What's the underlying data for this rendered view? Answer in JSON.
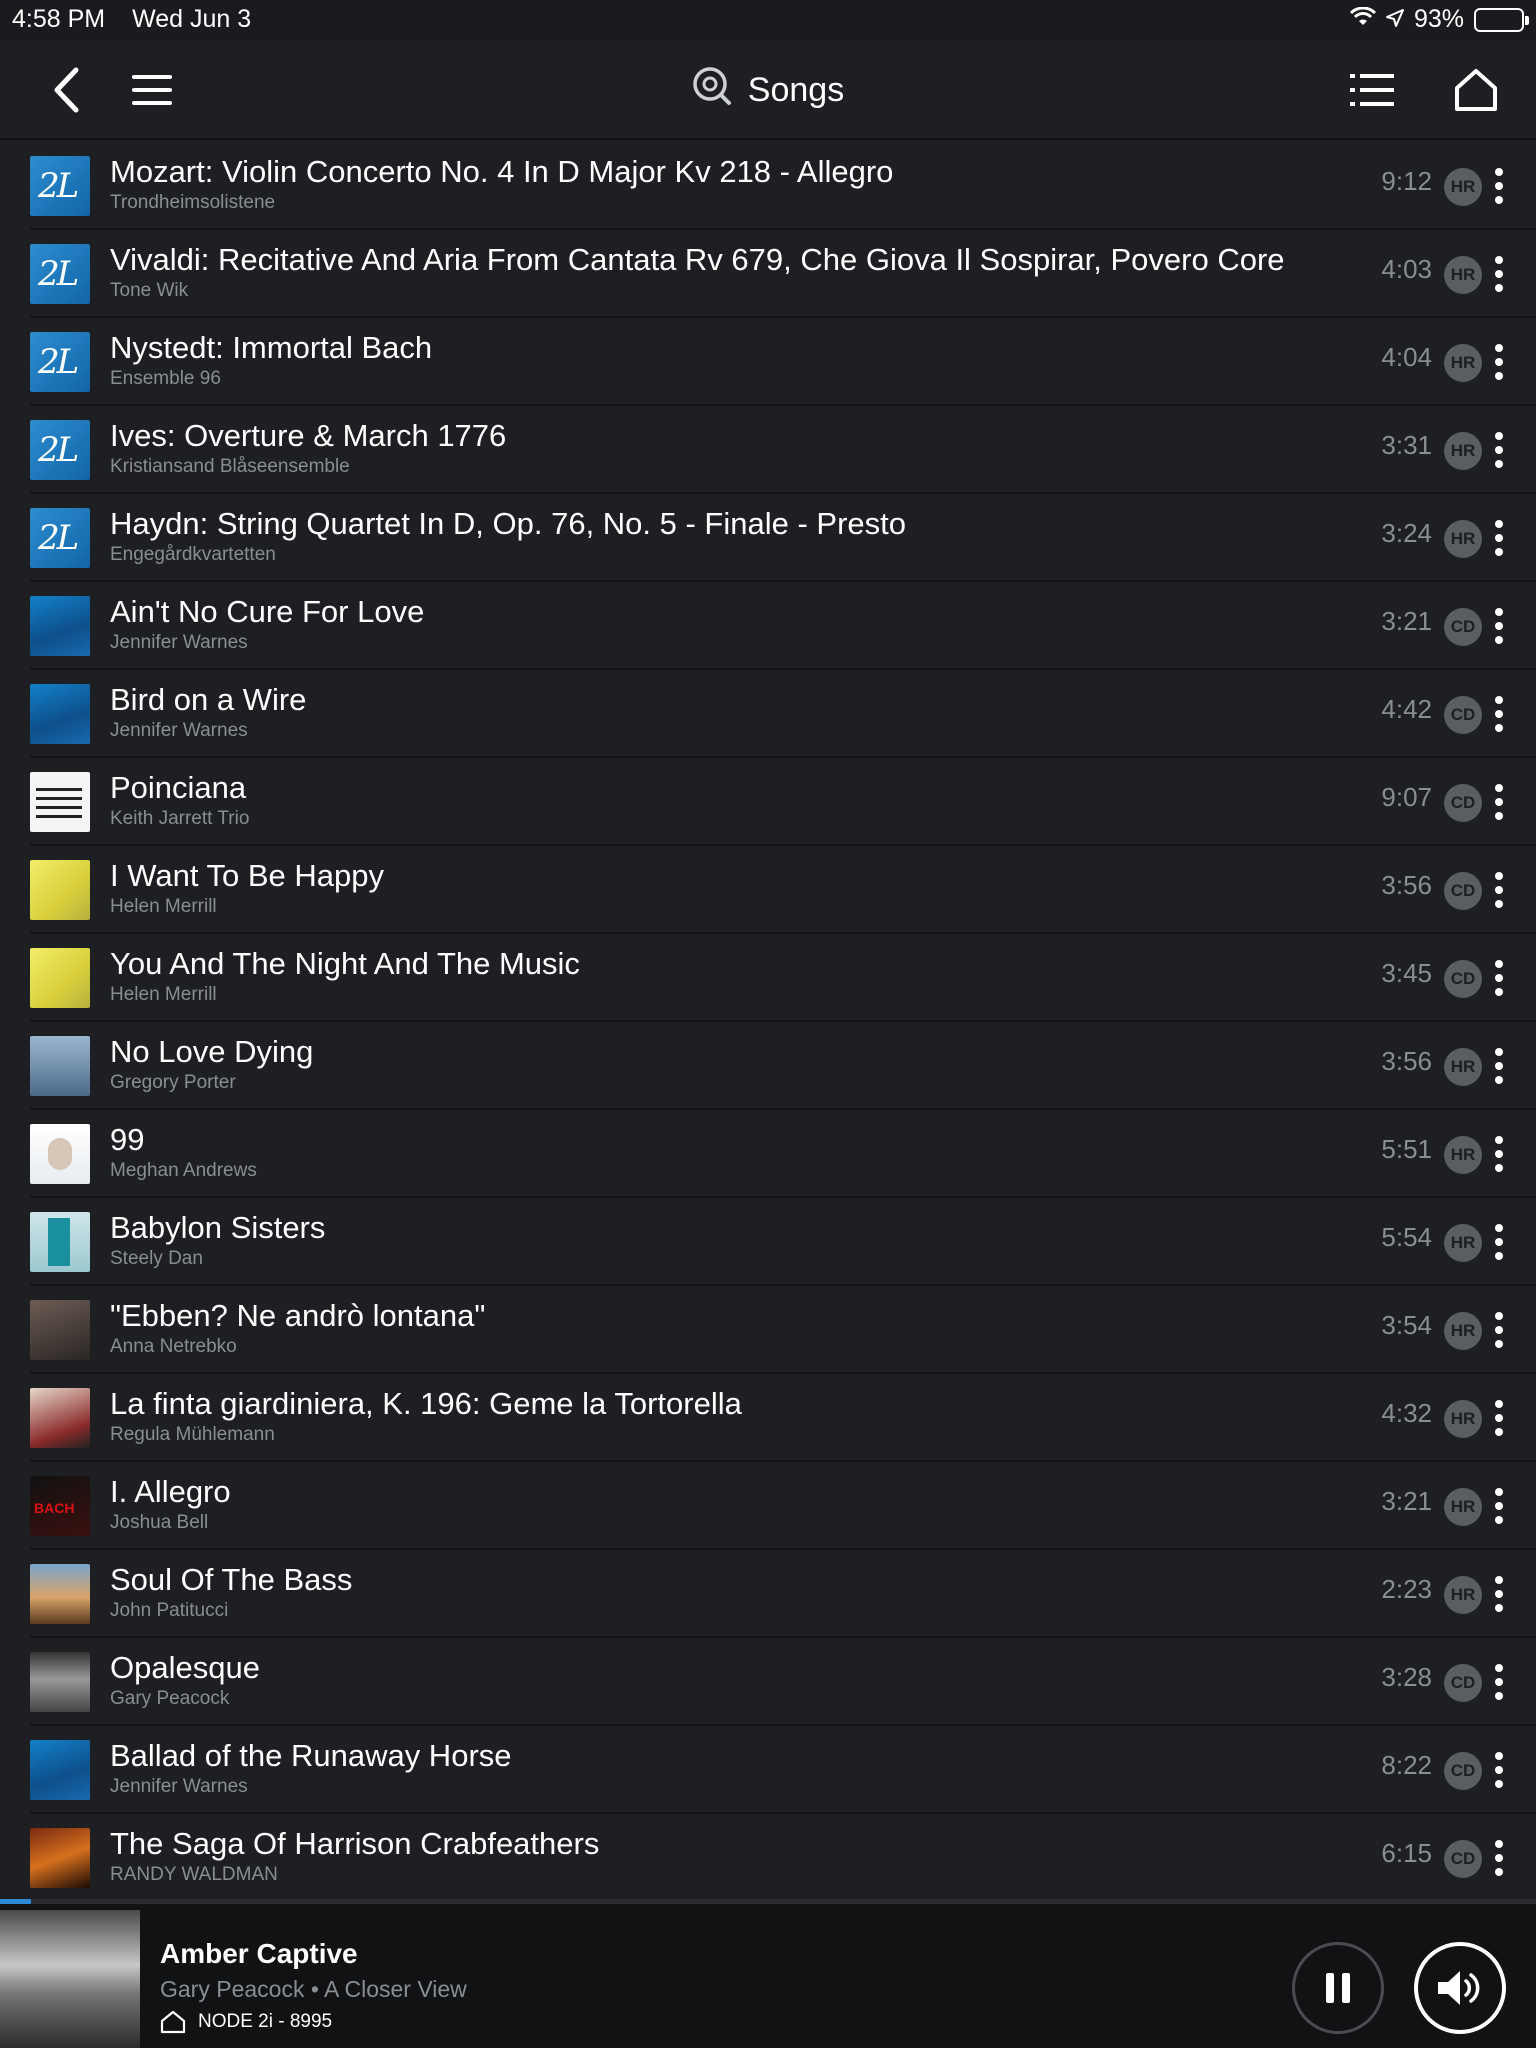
{
  "status_bar": {
    "time": "4:58 PM",
    "date": "Wed Jun 3",
    "battery": "93%"
  },
  "nav": {
    "title": "Songs"
  },
  "songs": [
    {
      "title": "Mozart: Violin Concerto No. 4 In D Major Kv 218 - Allegro",
      "artist": "Trondheimsolistene",
      "duration": "9:12",
      "quality": "HR",
      "art": "twoL"
    },
    {
      "title": "Vivaldi: Recitative And Aria From Cantata Rv 679, Che Giova Il Sospirar, Povero Core",
      "artist": "Tone Wik",
      "duration": "4:03",
      "quality": "HR",
      "art": "twoL"
    },
    {
      "title": "Nystedt: Immortal Bach",
      "artist": "Ensemble 96",
      "duration": "4:04",
      "quality": "HR",
      "art": "twoL"
    },
    {
      "title": "Ives: Overture & March 1776",
      "artist": "Kristiansand Blåseensemble",
      "duration": "3:31",
      "quality": "HR",
      "art": "twoL"
    },
    {
      "title": "Haydn: String Quartet In D, Op. 76, No. 5 - Finale - Presto",
      "artist": "Engegårdkvartetten",
      "duration": "3:24",
      "quality": "HR",
      "art": "twoL"
    },
    {
      "title": "Ain't No Cure For Love",
      "artist": "Jennifer Warnes",
      "duration": "3:21",
      "quality": "CD",
      "art": "blue"
    },
    {
      "title": "Bird on a Wire",
      "artist": "Jennifer Warnes",
      "duration": "4:42",
      "quality": "CD",
      "art": "blue"
    },
    {
      "title": "Poinciana",
      "artist": "Keith Jarrett Trio",
      "duration": "9:07",
      "quality": "CD",
      "art": "white"
    },
    {
      "title": "I Want To Be Happy",
      "artist": "Helen Merrill",
      "duration": "3:56",
      "quality": "CD",
      "art": "yellow"
    },
    {
      "title": "You And The Night And The Music",
      "artist": "Helen Merrill",
      "duration": "3:45",
      "quality": "CD",
      "art": "yellow"
    },
    {
      "title": "No Love Dying",
      "artist": "Gregory Porter",
      "duration": "3:56",
      "quality": "HR",
      "art": "porter"
    },
    {
      "title": "99",
      "artist": "Meghan Andrews",
      "duration": "5:51",
      "quality": "HR",
      "art": "meghan"
    },
    {
      "title": "Babylon Sisters",
      "artist": "Steely Dan",
      "duration": "5:54",
      "quality": "HR",
      "art": "steely"
    },
    {
      "title": "\"Ebben? Ne andrò lontana\"",
      "artist": "Anna Netrebko",
      "duration": "3:54",
      "quality": "HR",
      "art": "netrebko"
    },
    {
      "title": "La finta giardiniera, K. 196: Geme la Tortorella",
      "artist": "Regula Mühlemann",
      "duration": "4:32",
      "quality": "HR",
      "art": "muhlemann"
    },
    {
      "title": "I. Allegro",
      "artist": "Joshua Bell",
      "duration": "3:21",
      "quality": "HR",
      "art": "bell"
    },
    {
      "title": "Soul Of The Bass",
      "artist": "John Patitucci",
      "duration": "2:23",
      "quality": "HR",
      "art": "bass"
    },
    {
      "title": "Opalesque",
      "artist": "Gary Peacock",
      "duration": "3:28",
      "quality": "CD",
      "art": "opal"
    },
    {
      "title": "Ballad of the Runaway Horse",
      "artist": "Jennifer Warnes",
      "duration": "8:22",
      "quality": "CD",
      "art": "blue"
    },
    {
      "title": "The Saga Of Harrison Crabfeathers",
      "artist": "RANDY WALDMAN",
      "duration": "6:15",
      "quality": "CD",
      "art": "saga"
    }
  ],
  "now_playing": {
    "title": "Amber Captive",
    "subtitle": "Gary Peacock • A Closer View",
    "device": "NODE 2i - 8995",
    "progress_fraction": 0.02
  },
  "colors": {
    "background": "#1d1f22",
    "accent": "#2d8ad6",
    "secondary_text": "#8a8d92"
  },
  "icons": {
    "back": "chevron-left-icon",
    "menu": "hamburger-icon",
    "search": "search-icon",
    "queue": "list-icon",
    "home": "home-icon",
    "pause": "pause-icon",
    "volume": "volume-icon"
  }
}
